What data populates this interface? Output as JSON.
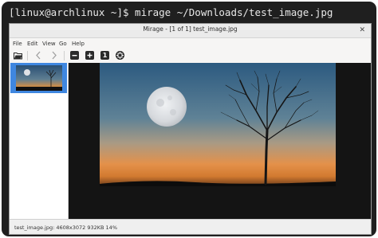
{
  "terminal": {
    "prompt": "[linux@archlinux ~]$ ",
    "command": "mirage ~/Downloads/test_image.jpg"
  },
  "window": {
    "title": "Mirage - [1 of 1] test_image.jpg",
    "close_glyph": "✕"
  },
  "menu": [
    "File",
    "Edit",
    "View",
    "Go",
    "Help"
  ],
  "toolbar": {
    "open_icon": "folder-open-icon",
    "prev_icon": "go-previous-icon",
    "next_icon": "go-next-icon",
    "zoom_out_icon": "zoom-out-icon",
    "zoom_in_icon": "zoom-in-icon",
    "zoom_1_label": "1",
    "zoom_fit_icon": "zoom-fit-icon"
  },
  "status": {
    "text": "test_image.jpg:  4608x3072   932KB   14%"
  },
  "colors": {
    "terminal_bg": "#1f1f1f",
    "selection": "#3f87e0",
    "viewer_bg": "#141414"
  }
}
